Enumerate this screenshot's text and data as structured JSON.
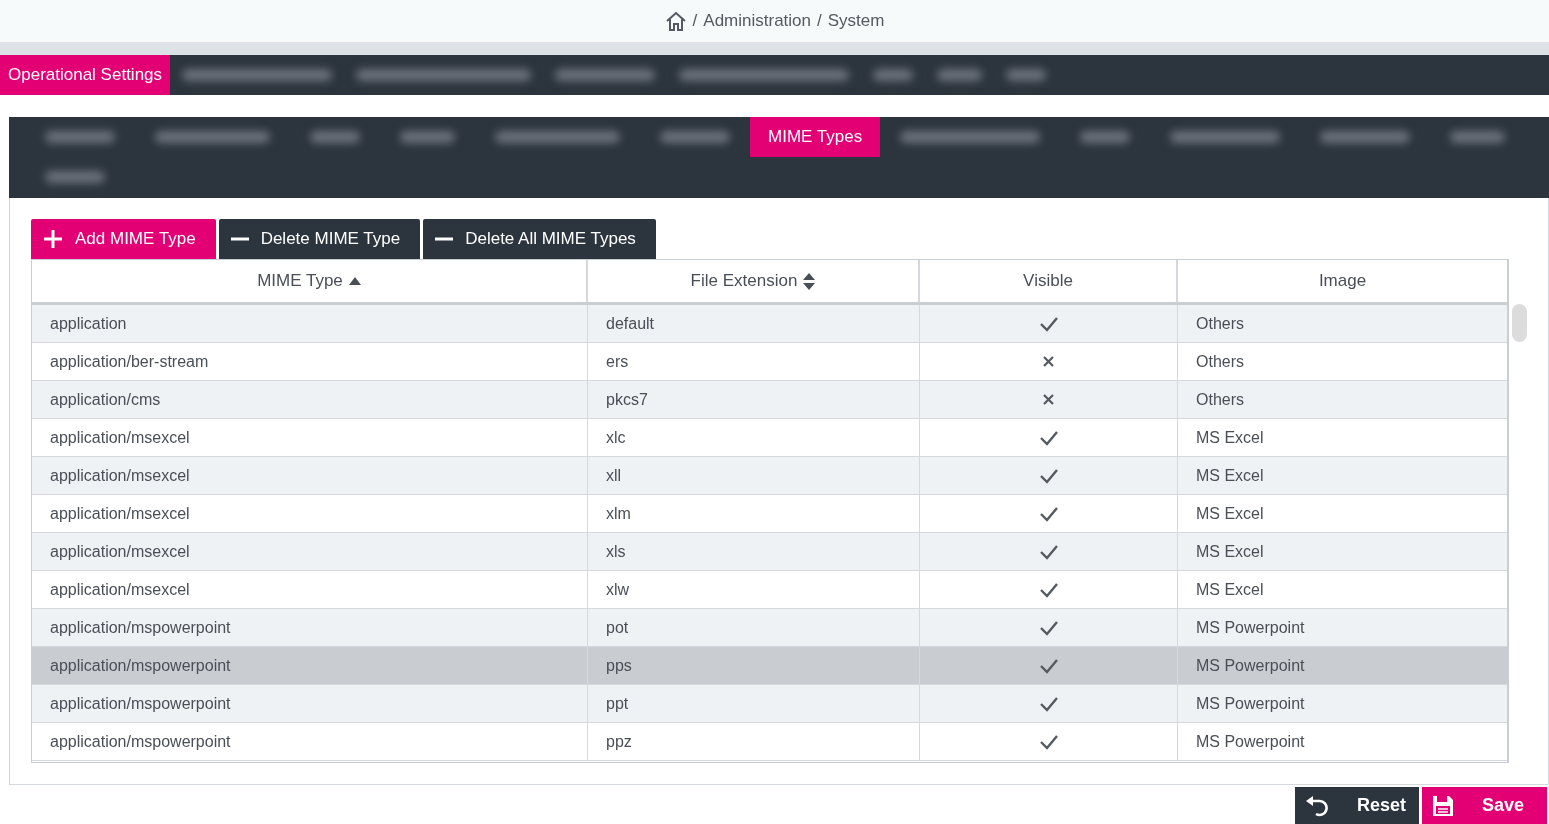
{
  "breadcrumb": {
    "separator": "/",
    "items": [
      "Administration",
      "System"
    ]
  },
  "main_nav": [
    {
      "kind": "text",
      "label": "Operational Settings",
      "selected": true
    },
    {
      "kind": "blurred",
      "selected": false
    },
    {
      "kind": "blurred",
      "selected": false
    },
    {
      "kind": "blurred",
      "selected": false
    },
    {
      "kind": "blurred",
      "selected": false
    },
    {
      "kind": "blurred",
      "selected": false
    },
    {
      "kind": "blurred",
      "selected": false
    },
    {
      "kind": "blurred",
      "selected": false
    }
  ],
  "sub_tabs": [
    {
      "kind": "blurred",
      "selected": false
    },
    {
      "kind": "blurred",
      "selected": false
    },
    {
      "kind": "blurred",
      "selected": false
    },
    {
      "kind": "blurred",
      "selected": false
    },
    {
      "kind": "blurred",
      "selected": false
    },
    {
      "kind": "blurred",
      "selected": false
    },
    {
      "kind": "text",
      "label": "MIME Types",
      "selected": true
    },
    {
      "kind": "blurred",
      "selected": false
    },
    {
      "kind": "blurred",
      "selected": false
    },
    {
      "kind": "blurred",
      "selected": false
    },
    {
      "kind": "blurred",
      "selected": false
    },
    {
      "kind": "blurred",
      "selected": false
    },
    {
      "kind": "blurred",
      "selected": false
    }
  ],
  "toolbar": [
    {
      "kind": "add",
      "label": "Add MIME Type"
    },
    {
      "kind": "remove",
      "label": "Delete MIME Type"
    },
    {
      "kind": "remove",
      "label": "Delete All MIME Types"
    }
  ],
  "table": {
    "columns": [
      {
        "label": "MIME Type",
        "sortable": true,
        "sorted": true
      },
      {
        "label": "File Extension",
        "sortable": true,
        "sorted": false
      },
      {
        "label": "Visible",
        "sortable": false,
        "sorted": false
      },
      {
        "label": "Image",
        "sortable": false,
        "sorted": false
      }
    ],
    "rows": [
      {
        "mime": "application",
        "ext": "default",
        "visible": true,
        "image": "Others",
        "selected": false
      },
      {
        "mime": "application/ber-stream",
        "ext": "ers",
        "visible": false,
        "image": "Others",
        "selected": false
      },
      {
        "mime": "application/cms",
        "ext": "pkcs7",
        "visible": false,
        "image": "Others",
        "selected": false
      },
      {
        "mime": "application/msexcel",
        "ext": "xlc",
        "visible": true,
        "image": "MS Excel",
        "selected": false
      },
      {
        "mime": "application/msexcel",
        "ext": "xll",
        "visible": true,
        "image": "MS Excel",
        "selected": false
      },
      {
        "mime": "application/msexcel",
        "ext": "xlm",
        "visible": true,
        "image": "MS Excel",
        "selected": false
      },
      {
        "mime": "application/msexcel",
        "ext": "xls",
        "visible": true,
        "image": "MS Excel",
        "selected": false
      },
      {
        "mime": "application/msexcel",
        "ext": "xlw",
        "visible": true,
        "image": "MS Excel",
        "selected": false
      },
      {
        "mime": "application/mspowerpoint",
        "ext": "pot",
        "visible": true,
        "image": "MS Powerpoint",
        "selected": false
      },
      {
        "mime": "application/mspowerpoint",
        "ext": "pps",
        "visible": true,
        "image": "MS Powerpoint",
        "selected": true
      },
      {
        "mime": "application/mspowerpoint",
        "ext": "ppt",
        "visible": true,
        "image": "MS Powerpoint",
        "selected": false
      },
      {
        "mime": "application/mspowerpoint",
        "ext": "ppz",
        "visible": true,
        "image": "MS Powerpoint",
        "selected": false
      }
    ]
  },
  "footer_buttons": [
    {
      "kind": "reset",
      "label": "Reset"
    },
    {
      "kind": "save",
      "label": "Save"
    }
  ]
}
